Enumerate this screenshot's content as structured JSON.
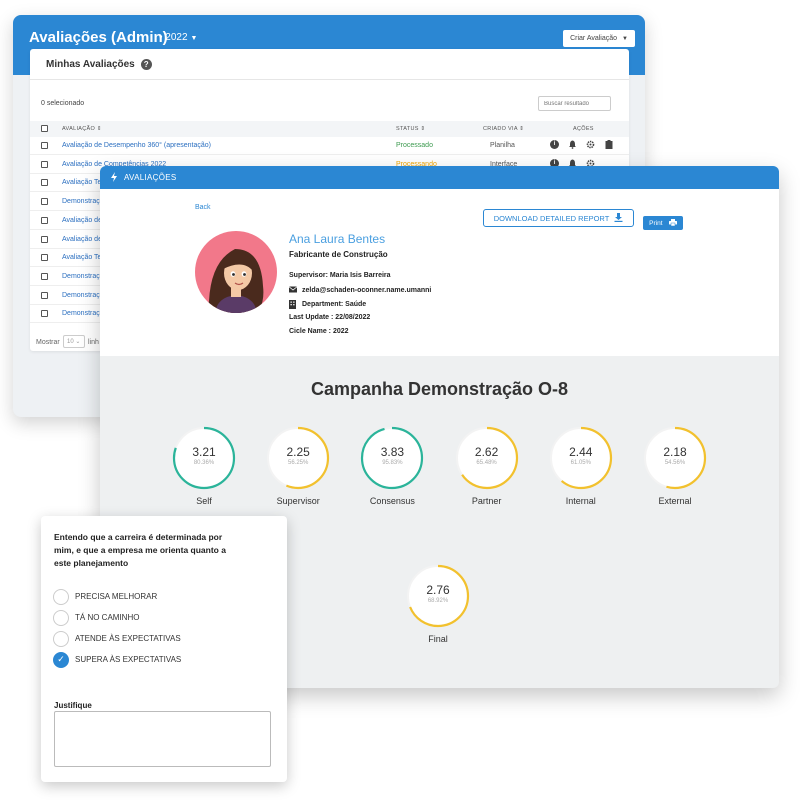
{
  "admin": {
    "title": "Avaliações (Admin)",
    "year": "• 2022",
    "create_button": "Criar Avaliação",
    "card_title": "Minhas Avaliações",
    "selected_count": "0 selecionado",
    "search_placeholder": "Buscar resultado",
    "columns": {
      "evaluation": "AVALIAÇÃO ⇕",
      "status": "STATUS ⇕",
      "created_via": "CRIADO VIA ⇕",
      "actions": "AÇÕES"
    },
    "rows": [
      {
        "name": "Avaliação de Desempenho 360° (apresentação)",
        "status": "Processado",
        "status_color": "#3c9a4f",
        "via": "Planilha"
      },
      {
        "name": "Avaliação de Competências 2022",
        "status": "Processando",
        "status_color": "#f0a500",
        "via": "Interface"
      },
      {
        "name": "Avaliação Te",
        "status": "",
        "status_color": "#3c9a4f",
        "via": ""
      },
      {
        "name": "Demonstraç",
        "status": "",
        "status_color": "#3c9a4f",
        "via": ""
      },
      {
        "name": "Avaliação de",
        "status": "",
        "status_color": "#3c9a4f",
        "via": ""
      },
      {
        "name": "Avaliação de",
        "status": "",
        "status_color": "#3c9a4f",
        "via": ""
      },
      {
        "name": "Avaliação Te",
        "status": "",
        "status_color": "#3c9a4f",
        "via": ""
      },
      {
        "name": "Demonstraç",
        "status": "",
        "status_color": "#3c9a4f",
        "via": ""
      },
      {
        "name": "Demonstraç",
        "status": "",
        "status_color": "#3c9a4f",
        "via": ""
      },
      {
        "name": "Demonstraç",
        "status": "",
        "status_color": "#3c9a4f",
        "via": ""
      }
    ],
    "show_label": "Mostrar",
    "show_value": "10 ⌄",
    "show_suffix": "linh"
  },
  "report": {
    "header": "AVALIAÇÕES",
    "back": "Back",
    "download_button": "DOWNLOAD DETAILED REPORT",
    "print_button": "Print",
    "person": {
      "name": "Ana Laura Bentes",
      "role": "Fabricante de Construção",
      "supervisor": "Supervisor: Maria Isis Barreira",
      "email": "zelda@schaden-oconner.name.umanni",
      "department": "Department: Saúde",
      "last_update": "Last Update : 22/08/2022",
      "cicle": "Cicle Name : 2022"
    },
    "campaign_title": "Campanha Demonstração O-8",
    "colors": {
      "green": "#2bb49a",
      "yellow": "#f2c12e",
      "primary": "#2b87d3"
    },
    "scores": [
      {
        "label": "Self",
        "value": "3.21",
        "percent": "80.36%",
        "fraction": 0.8036,
        "color": "#2bb49a"
      },
      {
        "label": "Supervisor",
        "value": "2.25",
        "percent": "56.25%",
        "fraction": 0.5625,
        "color": "#f2c12e"
      },
      {
        "label": "Consensus",
        "value": "3.83",
        "percent": "95.83%",
        "fraction": 0.9583,
        "color": "#2bb49a"
      },
      {
        "label": "Partner",
        "value": "2.62",
        "percent": "65.48%",
        "fraction": 0.6548,
        "color": "#f2c12e"
      },
      {
        "label": "Internal",
        "value": "2.44",
        "percent": "61.05%",
        "fraction": 0.6105,
        "color": "#f2c12e"
      },
      {
        "label": "External",
        "value": "2.18",
        "percent": "54.56%",
        "fraction": 0.5456,
        "color": "#f2c12e"
      }
    ],
    "final": {
      "label": "Final",
      "value": "2.76",
      "percent": "68.92%",
      "fraction": 0.6892,
      "color": "#f2c12e"
    }
  },
  "question": {
    "text": "Entendo que a carreira é determinada por mim, e que a empresa me orienta quanto a este planejamento",
    "options": [
      {
        "label": "PRECISA MELHORAR",
        "checked": false
      },
      {
        "label": "TÁ NO CAMINHO",
        "checked": false
      },
      {
        "label": "ATENDE ÀS EXPECTATIVAS",
        "checked": false
      },
      {
        "label": "SUPERA ÀS EXPECTATIVAS",
        "checked": true
      }
    ],
    "justify_label": "Justifique",
    "justify_value": ""
  }
}
